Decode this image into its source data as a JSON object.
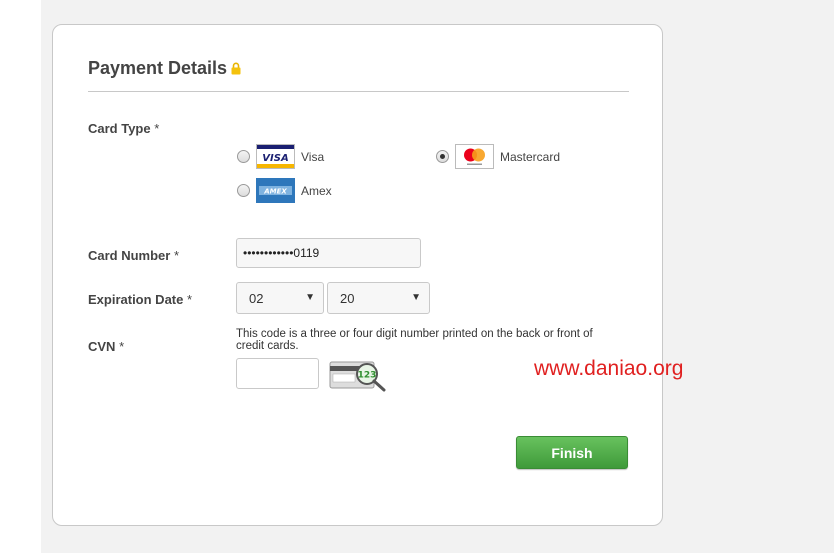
{
  "form": {
    "title": "Payment Details",
    "lock_icon": "lock-icon"
  },
  "card_type": {
    "label": "Card Type",
    "required_mark": " *",
    "options": [
      {
        "name": "Visa",
        "logo": "visa-logo",
        "checked": false
      },
      {
        "name": "Mastercard",
        "logo": "mastercard-logo",
        "checked": true
      },
      {
        "name": "Amex",
        "logo": "amex-logo",
        "checked": false
      }
    ]
  },
  "card_number": {
    "label": "Card Number",
    "required_mark": " *",
    "value": "••••••••••••0119"
  },
  "expiration": {
    "label": "Expiration Date",
    "required_mark": " *",
    "month": "02",
    "year": "20"
  },
  "cvn": {
    "label": "CVN",
    "required_mark": " *",
    "note": "This code is a three or four digit number printed on the back or front of credit cards.",
    "value": "",
    "icon": "card-back-cvn-icon",
    "icon_text": "123"
  },
  "actions": {
    "finish_label": "Finish"
  },
  "watermark": "www.daniao.org",
  "colors": {
    "finish_green": "#4caf46",
    "watermark_red": "#e02020",
    "mastercard_red": "#eb001b",
    "mastercard_orange": "#f79e1b",
    "visa_blue": "#1a1f71"
  }
}
